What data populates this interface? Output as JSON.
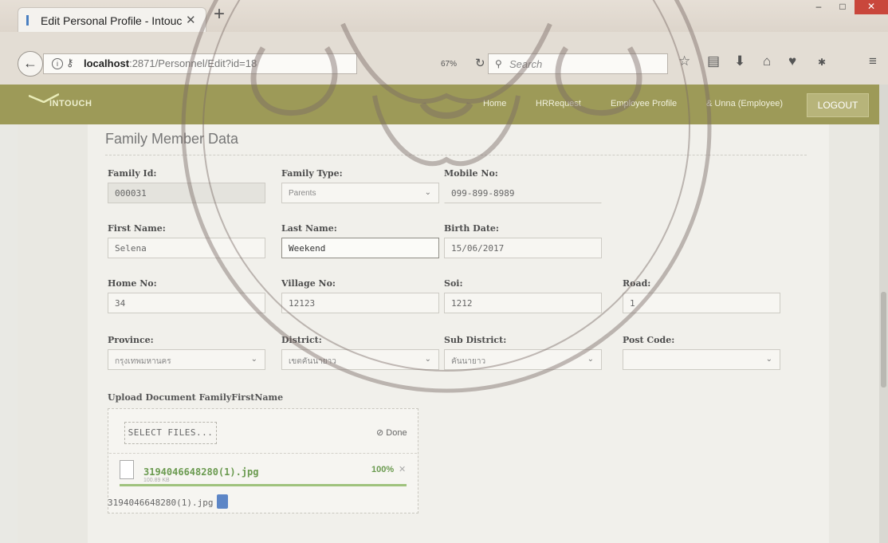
{
  "browser": {
    "tab_title": "Edit Personal Profile - Intouc",
    "tab_close": "✕",
    "new_tab": "+",
    "url_host": "localhost",
    "url_path": ":2871/Personnel/Edit?id=18",
    "zoom": "67%",
    "search_placeholder": "Search"
  },
  "app": {
    "logo": "INTOUCH",
    "nav": [
      "Home",
      "HRRequest",
      "Employee Profile",
      "& Unna (Employee)"
    ],
    "logout": "LOGOUT"
  },
  "form": {
    "title": "Family Member Data",
    "family_id": {
      "label": "Family Id:",
      "value": "000031"
    },
    "family_type": {
      "label": "Family Type:",
      "value": "Parents"
    },
    "mobile_no": {
      "label": "Mobile No:",
      "value": "099-899-8989"
    },
    "first_name": {
      "label": "First Name:",
      "value": "Selena"
    },
    "last_name": {
      "label": "Last Name:",
      "value": "Weekend"
    },
    "birth_date": {
      "label": "Birth Date:",
      "value": "15/06/2017"
    },
    "home_no": {
      "label": "Home No:",
      "value": "34"
    },
    "village_no": {
      "label": "Village No:",
      "value": "12123"
    },
    "soi": {
      "label": "Soi:",
      "value": "1212"
    },
    "road": {
      "label": "Road:",
      "value": "1"
    },
    "province": {
      "label": "Province:",
      "value": "กรุงเทพมหานคร"
    },
    "district": {
      "label": "District:",
      "value": "เขตคันนายาว"
    },
    "sub_district": {
      "label": "Sub District:",
      "value": "คันนายาว"
    },
    "post_code": {
      "label": "Post Code:",
      "value": ""
    }
  },
  "upload": {
    "title": "Upload Document FamilyFirstName",
    "select_button": "SELECT FILES...",
    "status": "Done",
    "file_name": "3194046648280(1).jpg",
    "file_size": "100.89 KB",
    "progress_text": "100%",
    "progress": 1.0,
    "saved_file": "3194046648280(1).jpg"
  },
  "colors": {
    "app_header": "#9d9a58",
    "success_green": "#6a9a4f",
    "watermark": "#7a6a66"
  }
}
